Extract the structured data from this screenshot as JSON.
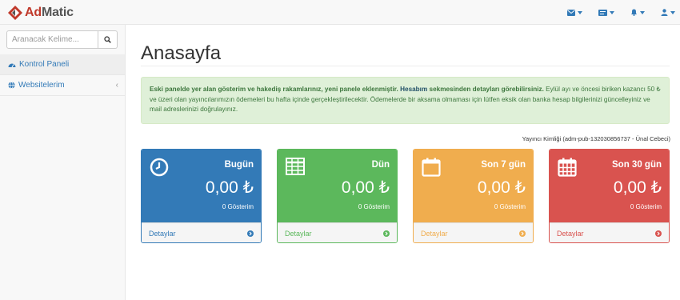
{
  "brand": {
    "prefix": "Ad",
    "suffix": "Matic"
  },
  "navbar": {
    "icons": [
      "envelope-icon",
      "tasks-icon",
      "bell-icon",
      "user-icon"
    ],
    "accent": "#337ab7"
  },
  "sidebar": {
    "search_placeholder": "Aranacak Kelime...",
    "items": [
      {
        "label": "Kontrol Paneli",
        "icon": "dashboard-icon",
        "active": true
      },
      {
        "label": "Websitelerim",
        "icon": "globe-icon",
        "chevron": "‹"
      }
    ]
  },
  "main": {
    "title": "Anasayfa",
    "alert": {
      "bold_start": "Eski panelde yer alan gösterim ve hakediş rakamlarınız, yeni panele eklenmiştir.",
      "link": "Hesabım",
      "bold_end": "sekmesinden detayları görebilirsiniz.",
      "body": "Eylül ayı ve öncesi biriken kazancı 50 ₺ ve üzeri olan yayıncılarımızın ödemeleri bu hafta içinde gerçekleştirilecektir. Ödemelerde bir aksama olmaması için lütfen eksik olan banka hesap bilgilerinizi güncelleyiniz ve mail adreslerinizi doğrulayınız."
    },
    "publisher_id": "Yayıncı Kimliği (adm-pub-132030856737 - Ünal Cebeci)"
  },
  "panels": [
    {
      "label": "Bugün",
      "amount": "0,00 ₺",
      "views": "0 Gösterim",
      "footer": "Detaylar",
      "icon": "clock-icon",
      "color": "#337ab7"
    },
    {
      "label": "Dün",
      "amount": "0,00 ₺",
      "views": "0 Gösterim",
      "footer": "Detaylar",
      "icon": "table-icon",
      "color": "#5cb85c"
    },
    {
      "label": "Son 7 gün",
      "amount": "0,00 ₺",
      "views": "0 Gösterim",
      "footer": "Detaylar",
      "icon": "calendar-icon",
      "color": "#f0ad4e"
    },
    {
      "label": "Son 30 gün",
      "amount": "0,00 ₺",
      "views": "0 Gösterim",
      "footer": "Detaylar",
      "icon": "calendar-grid-icon",
      "color": "#d9534f"
    }
  ]
}
